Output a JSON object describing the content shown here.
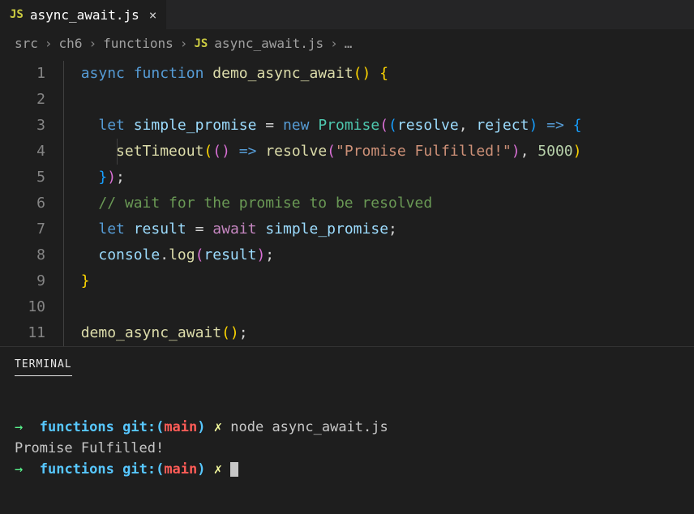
{
  "tab": {
    "icon_label": "JS",
    "filename": "async_await.js",
    "close_glyph": "×"
  },
  "breadcrumb": {
    "parts": [
      "src",
      "ch6",
      "functions"
    ],
    "file_icon": "JS",
    "file": "async_await.js",
    "tail": "…",
    "sep": "›"
  },
  "code": {
    "line_numbers": [
      "1",
      "2",
      "3",
      "4",
      "5",
      "6",
      "7",
      "8",
      "9",
      "10",
      "11"
    ],
    "tokens": {
      "l1": {
        "async": "async",
        "function": "function",
        "name": "demo_async_await"
      },
      "l3": {
        "let": "let",
        "var": "simple_promise",
        "eq": "=",
        "new": "new",
        "cls": "Promise",
        "resolve": "resolve",
        "reject": "reject",
        "arrow": "=>"
      },
      "l4": {
        "fn": "setTimeout",
        "arrow": "=>",
        "resolve": "resolve",
        "str": "\"Promise Fulfilled!\"",
        "num": "5000"
      },
      "l5": {},
      "l6": {
        "cmt": "// wait for the promise to be resolved"
      },
      "l7": {
        "let": "let",
        "var": "result",
        "eq": "=",
        "await": "await",
        "rhs": "simple_promise"
      },
      "l8": {
        "obj": "console",
        "method": "log",
        "arg": "result"
      },
      "l11": {
        "call": "demo_async_await"
      }
    }
  },
  "terminal": {
    "header": "TERMINAL",
    "arrow": "→",
    "dir": "functions",
    "git": "git:",
    "lparen": "(",
    "branch": "main",
    "rparen": ")",
    "dirty": "✗",
    "cmd1": "node async_await.js",
    "output": "Promise Fulfilled!"
  }
}
